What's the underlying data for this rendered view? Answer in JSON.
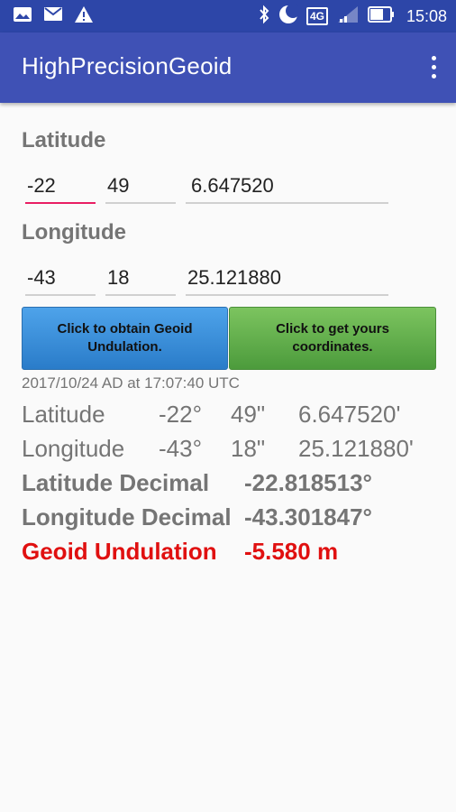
{
  "status_bar": {
    "time": "15:08",
    "network_label": "4G",
    "icons": [
      "gallery-icon",
      "mail-icon",
      "warning-icon",
      "bluetooth-icon",
      "moon-icon",
      "signal-icon",
      "battery-icon"
    ]
  },
  "app_bar": {
    "title": "HighPrecisionGeoid",
    "overflow_icon": "more-vert-icon",
    "color": "#3f51b5"
  },
  "latitude": {
    "label": "Latitude",
    "degrees": "-22",
    "minutes": "49",
    "seconds": "6.647520"
  },
  "longitude": {
    "label": "Longitude",
    "degrees": "-43",
    "minutes": "18",
    "seconds": "25.121880"
  },
  "buttons": {
    "geoid": "Click to obtain Geoid Undulation.",
    "coords": "Click to get yours coordinates."
  },
  "results": {
    "timestamp": "2017/10/24 AD at 17:07:40 UTC",
    "lat_label": "Latitude",
    "lat_deg": "-22°",
    "lat_min": "49\"",
    "lat_sec": "6.647520'",
    "lon_label": "Longitude",
    "lon_deg": "-43°",
    "lon_min": "18\"",
    "lon_sec": "25.121880'",
    "lat_dec_label": "Latitude Decimal",
    "lat_dec_value": "-22.818513°",
    "lon_dec_label": "Longitude Decimal",
    "lon_dec_value": "-43.301847°",
    "geoid_label": "Geoid Undulation",
    "geoid_value": "-5.580 m",
    "highlight_color": "#e01010"
  }
}
